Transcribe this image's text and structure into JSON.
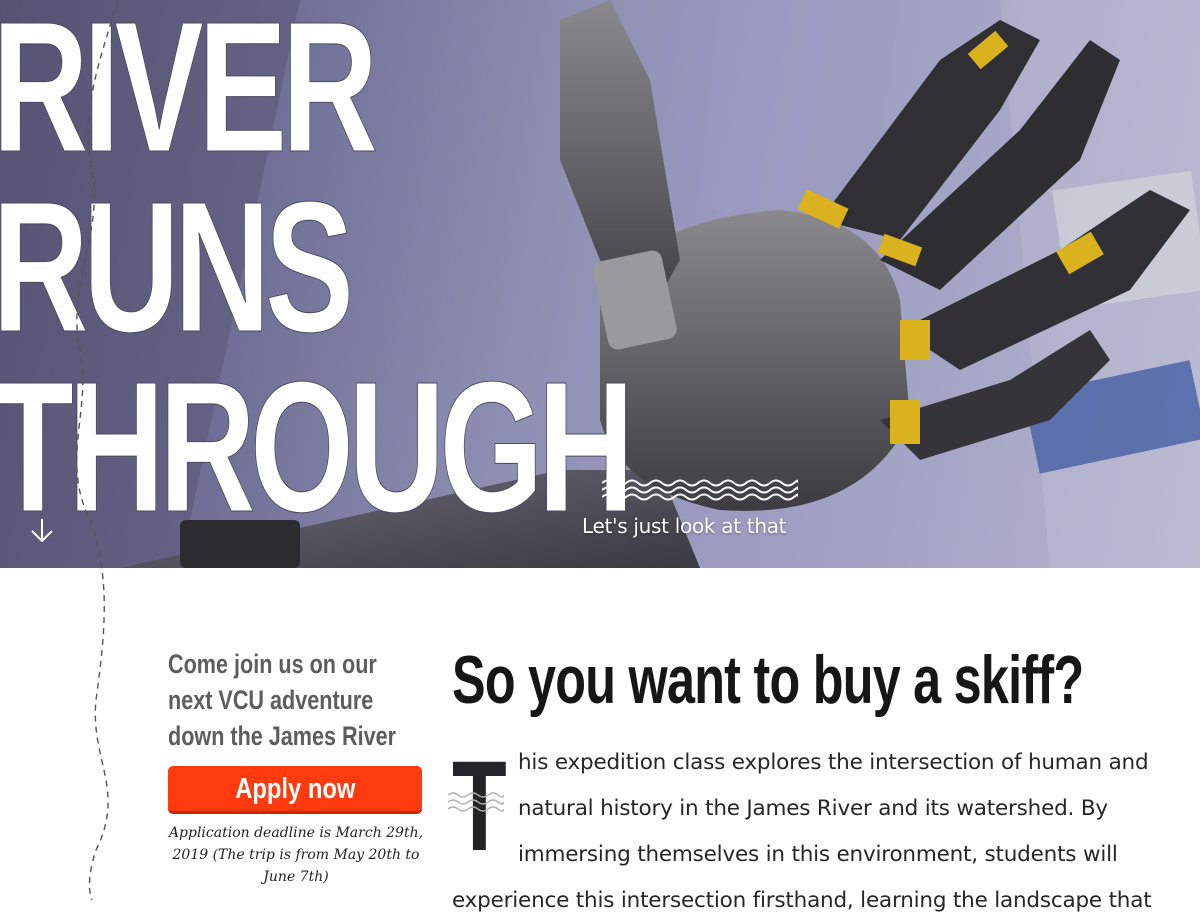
{
  "hero": {
    "title_lines": [
      "RIVER",
      "RUNS",
      "THROUGH"
    ],
    "subtitle": "Let's just look at that",
    "background": "robotic-hand-photo"
  },
  "sidebar": {
    "heading": "Come join us on our next VCU adventure down the James River",
    "apply_label": "Apply now",
    "deadline": "Application deadline is March 29th, 2019 (The trip is from May 20th to June 7th)"
  },
  "main": {
    "heading": "So you want to buy a skiff?",
    "dropcap": "T",
    "paragraph": "his expedition class explores the intersection of human and natural history in the James River and its watershed. By immersing themselves in this environment, students will experience this intersection firsthand, learning the landscape that"
  },
  "colors": {
    "accent": "#ff3b0f",
    "heading_gray": "#5d5d5d",
    "text": "#262626"
  },
  "icons": {
    "scroll": "arrow-down-icon",
    "waves": "waves-icon"
  }
}
